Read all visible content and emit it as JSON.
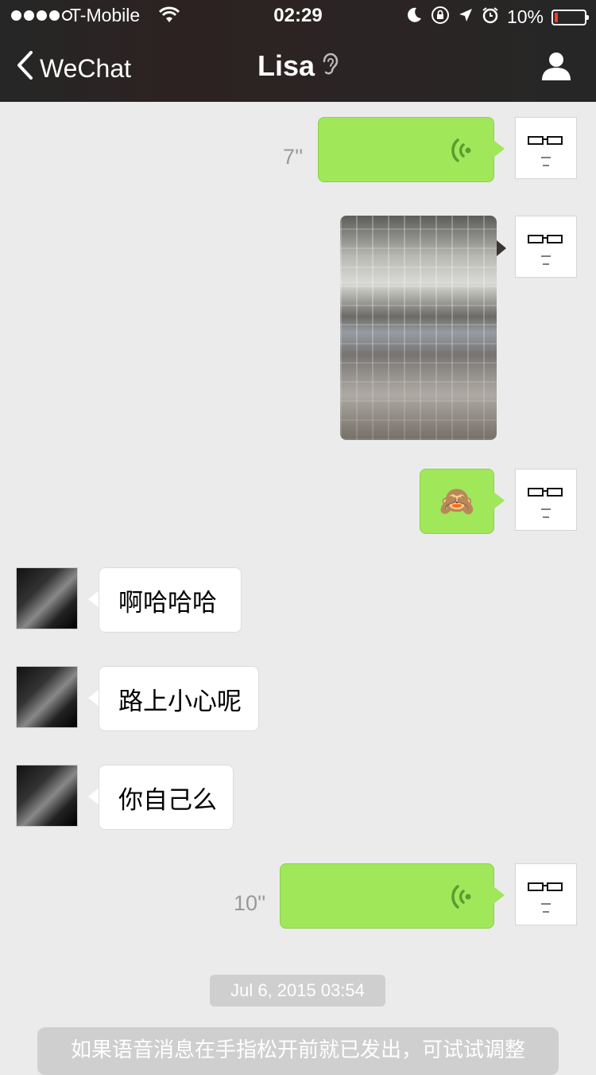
{
  "status_bar": {
    "carrier": "T-Mobile",
    "time": "02:29",
    "battery": "10%",
    "battery_level": 0.1,
    "signal_bars_filled": 4,
    "signal_bars_total": 5
  },
  "nav": {
    "back_label": "WeChat",
    "title": "Lisa",
    "title_icon": "ear-icon",
    "right_icon": "profile-icon"
  },
  "colors": {
    "sent_bubble": "#a0e75a",
    "received_bubble": "#ffffff",
    "background": "#ebebeb",
    "header": "#262626"
  },
  "messages": [
    {
      "from": "me",
      "type": "voice",
      "duration": "7''"
    },
    {
      "from": "me",
      "type": "image"
    },
    {
      "from": "me",
      "type": "emoji",
      "emoji": "🙈"
    },
    {
      "from": "lisa",
      "type": "text",
      "text": "啊哈哈哈"
    },
    {
      "from": "lisa",
      "type": "text",
      "text": "路上小心呢"
    },
    {
      "from": "lisa",
      "type": "text",
      "text": "你自己么"
    },
    {
      "from": "me",
      "type": "voice",
      "duration": "10''"
    }
  ],
  "timestamp": "Jul 6, 2015 03:54",
  "system_tip": "如果语音消息在手指松开前就已发出，可试试调整"
}
